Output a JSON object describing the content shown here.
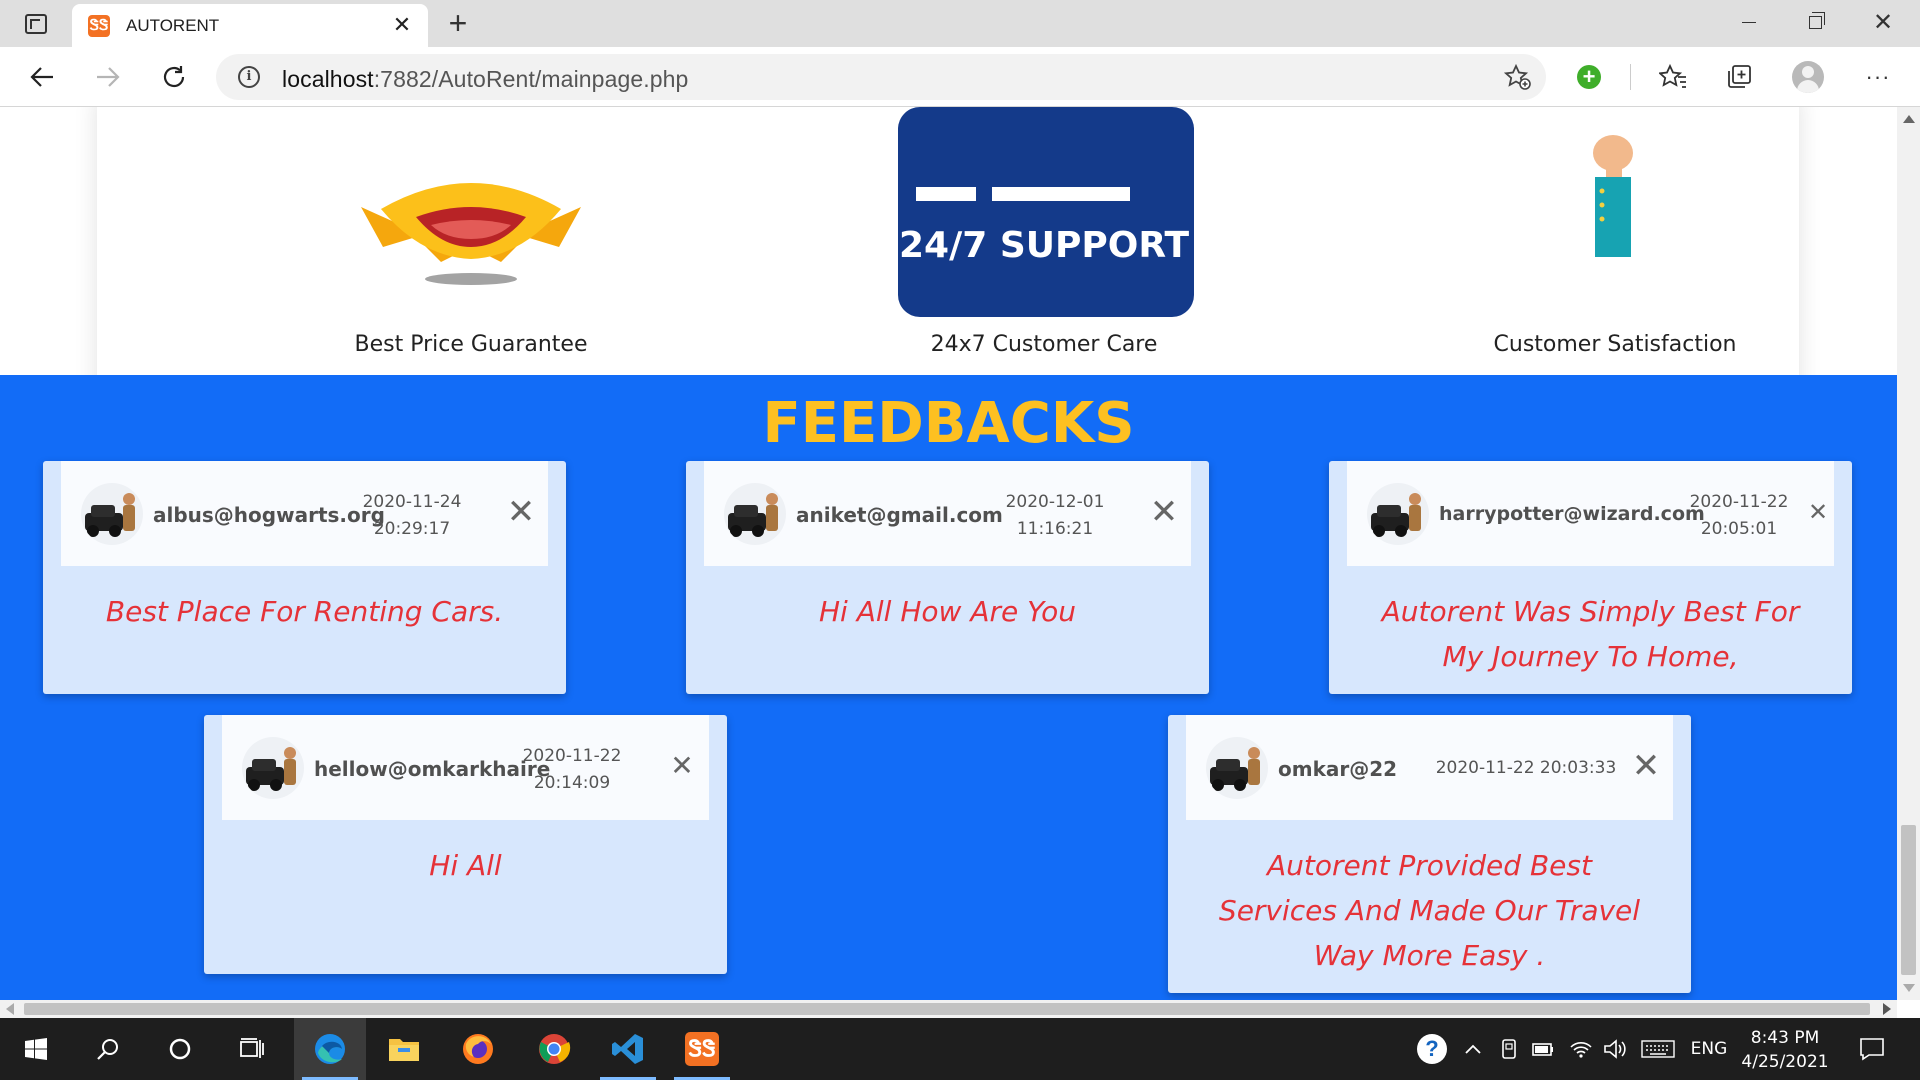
{
  "browser": {
    "tab_title": "AUTORENT",
    "tab_close": "✕",
    "new_tab": "+",
    "url_host": "localhost",
    "url_rest": ":7882/AutoRent/mainpage.php"
  },
  "features": {
    "price_label": "Best Price Guarantee",
    "support_label": "24x7 Customer Care",
    "support_banner": "24/7 SUPPORT",
    "satisfaction_label": "Customer Satisfaction"
  },
  "feedback": {
    "title": "FEEDBACKS",
    "close_glyph": "✕",
    "cards": [
      {
        "email": "albus@hogwarts.org",
        "date": "2020-11-24",
        "time": "20:29:17",
        "message": "Best Place For Renting Cars."
      },
      {
        "email": "aniket@gmail.com",
        "date": "2020-12-01",
        "time": "11:16:21",
        "message": "Hi All How Are You"
      },
      {
        "email": "harrypotter@wizard.com",
        "date": "2020-11-22",
        "time": "20:05:01",
        "message": "Autorent Was Simply Best For My Journey To Home,"
      },
      {
        "email": "hellow@omkarkhaire",
        "date": "2020-11-22",
        "time": "20:14:09",
        "message": "Hi All"
      },
      {
        "email": "omkar@22",
        "datetime": "2020-11-22 20:03:33",
        "message": "Autorent Provided Best Services And Made Our Travel Way More Easy ."
      }
    ]
  },
  "taskbar": {
    "language": "ENG",
    "time": "8:43 PM",
    "date": "4/25/2021"
  },
  "colors": {
    "feedback_bg": "#126cf7",
    "feedback_title": "#fdc021",
    "card_bg": "#d7e7fd",
    "message_text": "#e53238"
  },
  "icons": {
    "browser": [
      "tab-actions-icon",
      "refresh-icon",
      "back-arrow-icon",
      "forward-arrow-icon",
      "info-icon",
      "add-favorite-icon",
      "extension-icon",
      "favorites-icon",
      "collections-icon",
      "profile-icon",
      "more-icon"
    ],
    "taskbar": [
      "windows-start-icon",
      "search-icon",
      "cortana-icon",
      "task-view-icon",
      "edge-icon",
      "file-explorer-icon",
      "firefox-icon",
      "chrome-icon",
      "vscode-icon",
      "xampp-icon",
      "help-icon",
      "chevron-up-icon",
      "battery-icon",
      "wifi-icon",
      "volume-icon",
      "keyboard-icon",
      "notification-icon"
    ]
  }
}
